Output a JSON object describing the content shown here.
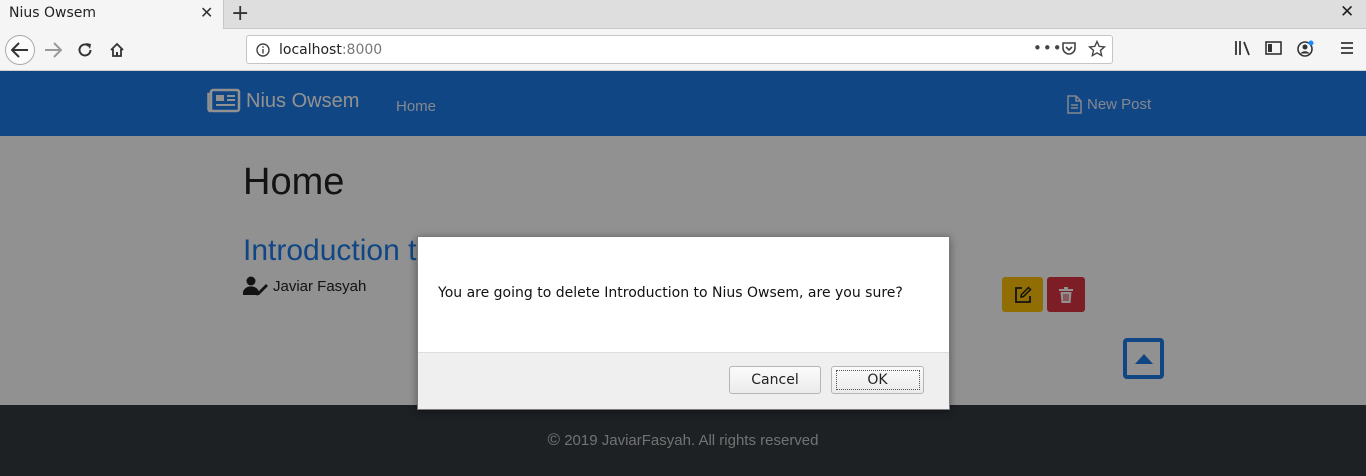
{
  "browser": {
    "tab_title": "Nius Owsem",
    "tab_close": "✕",
    "new_tab": "+",
    "window_close": "✕",
    "url_host": "localhost",
    "url_port": ":8000",
    "url_more": "•••"
  },
  "site": {
    "brand": "Nius Owsem",
    "nav_home": "Home",
    "nav_new_post": "New Post",
    "colors": {
      "primary": "#1d7be8",
      "warning": "#ffc107",
      "danger": "#dc3545",
      "footer": "#343a40"
    }
  },
  "main": {
    "page_title": "Home",
    "post_title": "Introduction t",
    "post_author": "Javiar Fasyah"
  },
  "footer": {
    "copyright_symbol": "©",
    "text": "2019 JaviarFasyah. All rights reserved"
  },
  "dialog": {
    "message": "You are going to delete Introduction to Nius Owsem, are you sure?",
    "cancel_label": "Cancel",
    "ok_label": "OK"
  }
}
